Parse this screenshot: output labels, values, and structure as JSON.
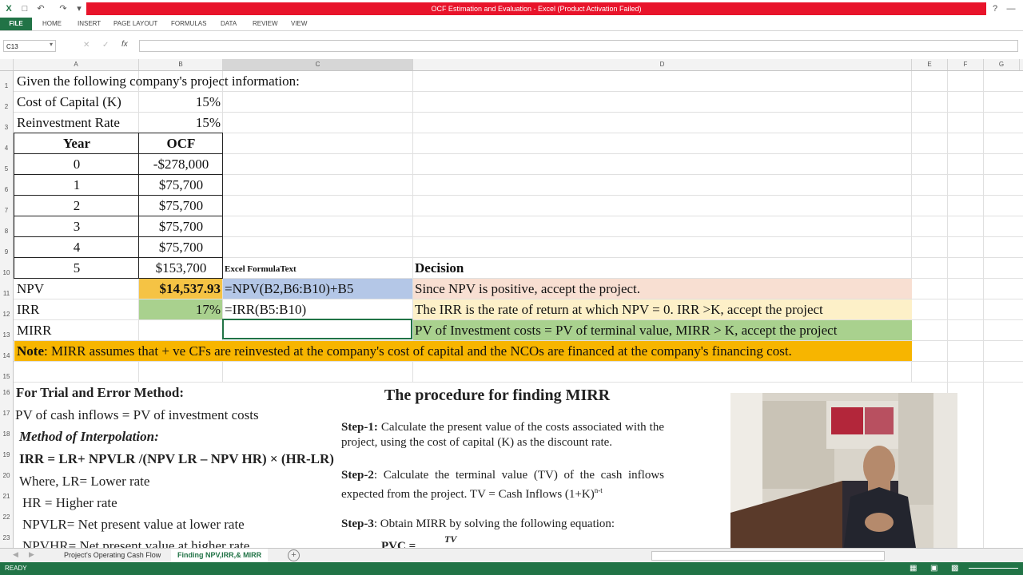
{
  "window": {
    "title": "OCF Estimation and Evaluation -  Excel (Product Activation Failed)",
    "help_label": "?"
  },
  "ribbon": {
    "tabs": [
      "FILE",
      "HOME",
      "INSERT",
      "PAGE LAYOUT",
      "FORMULAS",
      "DATA",
      "REVIEW",
      "VIEW"
    ]
  },
  "formula_bar": {
    "name_box": "C13",
    "fx_label": "fx",
    "value": ""
  },
  "columns": [
    "A",
    "B",
    "C",
    "D",
    "E",
    "F",
    "G"
  ],
  "rows": [
    "1",
    "2",
    "3",
    "4",
    "5",
    "6",
    "7",
    "8",
    "9",
    "10",
    "11",
    "12",
    "13",
    "14",
    "15",
    "16",
    "17",
    "18",
    "19",
    "20",
    "21",
    "22",
    "23"
  ],
  "cells": {
    "a1": "Given the following company's project information:",
    "a2": "Cost of Capital (K)",
    "b2": "15%",
    "a3": "Reinvestment Rate",
    "b3": "15%",
    "a4": "Year",
    "b4": "OCF",
    "a5": "0",
    "b5": "-$278,000",
    "a6": "1",
    "b6": "$75,700",
    "a7": "2",
    "b7": "$75,700",
    "a8": "3",
    "b8": "$75,700",
    "a9": "4",
    "b9": "$75,700",
    "a10": "5",
    "b10": "$153,700",
    "c10": "Excel FormulaText",
    "d10": "Decision",
    "a11": "NPV",
    "b11": "$14,537.93",
    "c11": "=NPV(B2,B6:B10)+B5",
    "d11": "Since NPV is positive, accept the project.",
    "a12": "IRR",
    "b12": "17%",
    "c12": "=IRR(B5:B10)",
    "d12": " The IRR is the rate of return at which NPV = 0. IRR >K, accept the project",
    "a13": "MIRR",
    "d13": "PV of Investment costs = PV of terminal value, MIRR > K, accept the project",
    "note_label": "Note",
    "note_text": ": MIRR assumes that + ve CFs are reinvested at the company's cost of capital and the NCOs are financed at the company's financing cost."
  },
  "trial_box": {
    "heading": "For Trial and Error Method:",
    "line1": "PV of cash inflows = PV of investment costs",
    "method": "Method of Interpolation",
    "method_colon": ":",
    "formula": "IRR = LR+ NPVLR /(NPV LR – NPV HR) × (HR-LR)",
    "where_lr": "Where, LR= Lower rate",
    "hr": "HR = Higher rate",
    "npvlr": "NPVLR= Net present value at lower rate",
    "npvhr": "NPVHR= Net present value at higher rate"
  },
  "mirr_box": {
    "title": "The procedure for finding MIRR",
    "step1_label": "Step-1:",
    "step1_text": " Calculate the present value of the costs associated with the project, using the cost of capital (K) as the discount rate.",
    "step2_label": "Step-2",
    "step2_text": ": Calculate the terminal value (TV) of the cash inflows expected from the project. TV = Cash Inflows (1+K)",
    "step2_sup": "n-t",
    "step3_label": "Step-3",
    "step3_text": ": Obtain MIRR by solving the following equation:",
    "eq_left": "PVC =",
    "eq_tv": "TV"
  },
  "sheet_tabs": [
    "Project's Operating Cash Flow",
    "Finding NPV,IRR,& MIRR"
  ],
  "active_sheet": "Finding NPV,IRR,& MIRR",
  "status": {
    "text": "READY"
  },
  "colors": {
    "excel_green": "#217346",
    "title_red": "#e8142b",
    "npv_yellow": "#f5c344",
    "irr_green": "#a9d18e",
    "formula_blue": "#b4c7e7",
    "decision_peach": "#f8dfd2",
    "decision_yellow": "#fdf0c8",
    "decision_green": "#a9d18e",
    "note_orange": "#f7b500"
  }
}
